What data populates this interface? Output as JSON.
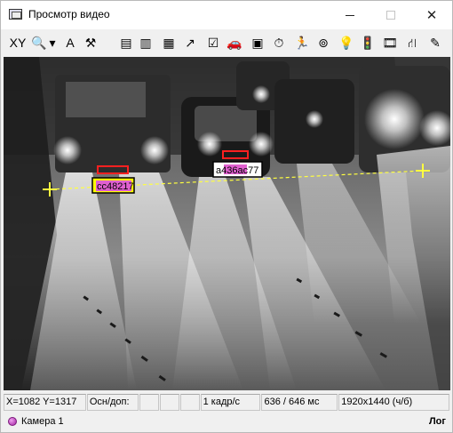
{
  "window": {
    "title": "Просмотр видео"
  },
  "toolbar": {
    "buttons": [
      {
        "name": "xy-icon",
        "glyph": "XY"
      },
      {
        "name": "zoom-icon",
        "glyph": "🔍"
      },
      {
        "name": "dropdown-arrow-icon",
        "glyph": "▾"
      },
      {
        "name": "font-icon",
        "glyph": "A"
      },
      {
        "name": "tools-icon",
        "glyph": "⚒"
      },
      {
        "name": "properties-icon",
        "glyph": "▤"
      },
      {
        "name": "books-icon",
        "glyph": "▥"
      },
      {
        "name": "folder-icon",
        "glyph": "▦"
      },
      {
        "name": "chart-icon",
        "glyph": "↗"
      },
      {
        "name": "report-icon",
        "glyph": "☑"
      },
      {
        "name": "car-icon",
        "glyph": "🚗"
      },
      {
        "name": "frame-icon",
        "glyph": "▣"
      },
      {
        "name": "stopwatch-icon",
        "glyph": "⏱"
      },
      {
        "name": "runner-icon",
        "glyph": "🏃"
      },
      {
        "name": "search-globe-icon",
        "glyph": "⊚"
      },
      {
        "name": "bulb-icon",
        "glyph": "💡"
      },
      {
        "name": "traffic-light-icon",
        "glyph": "🚦"
      },
      {
        "name": "film-icon",
        "glyph": "🎞"
      },
      {
        "name": "network-icon",
        "glyph": "⛙"
      },
      {
        "name": "edit-icon",
        "glyph": "✎"
      }
    ]
  },
  "video": {
    "plates": [
      {
        "text": "cc48217"
      },
      {
        "text": "a436ac77"
      }
    ]
  },
  "statusbar": {
    "coords": "X=1082 Y=1317",
    "mode": "Осн/доп:",
    "empty1": "",
    "empty2": "",
    "empty3": "",
    "fps": "1 кадр/с",
    "timing": "636 / 646 мс",
    "resolution": "1920x1440 (ч/б)"
  },
  "camerabar": {
    "camera": "Камера 1",
    "log": "Лог"
  },
  "colors": {
    "accent_magenta": "#c020c0",
    "plate_yellow": "#ffff00",
    "line_yellow": "#ffff40"
  }
}
